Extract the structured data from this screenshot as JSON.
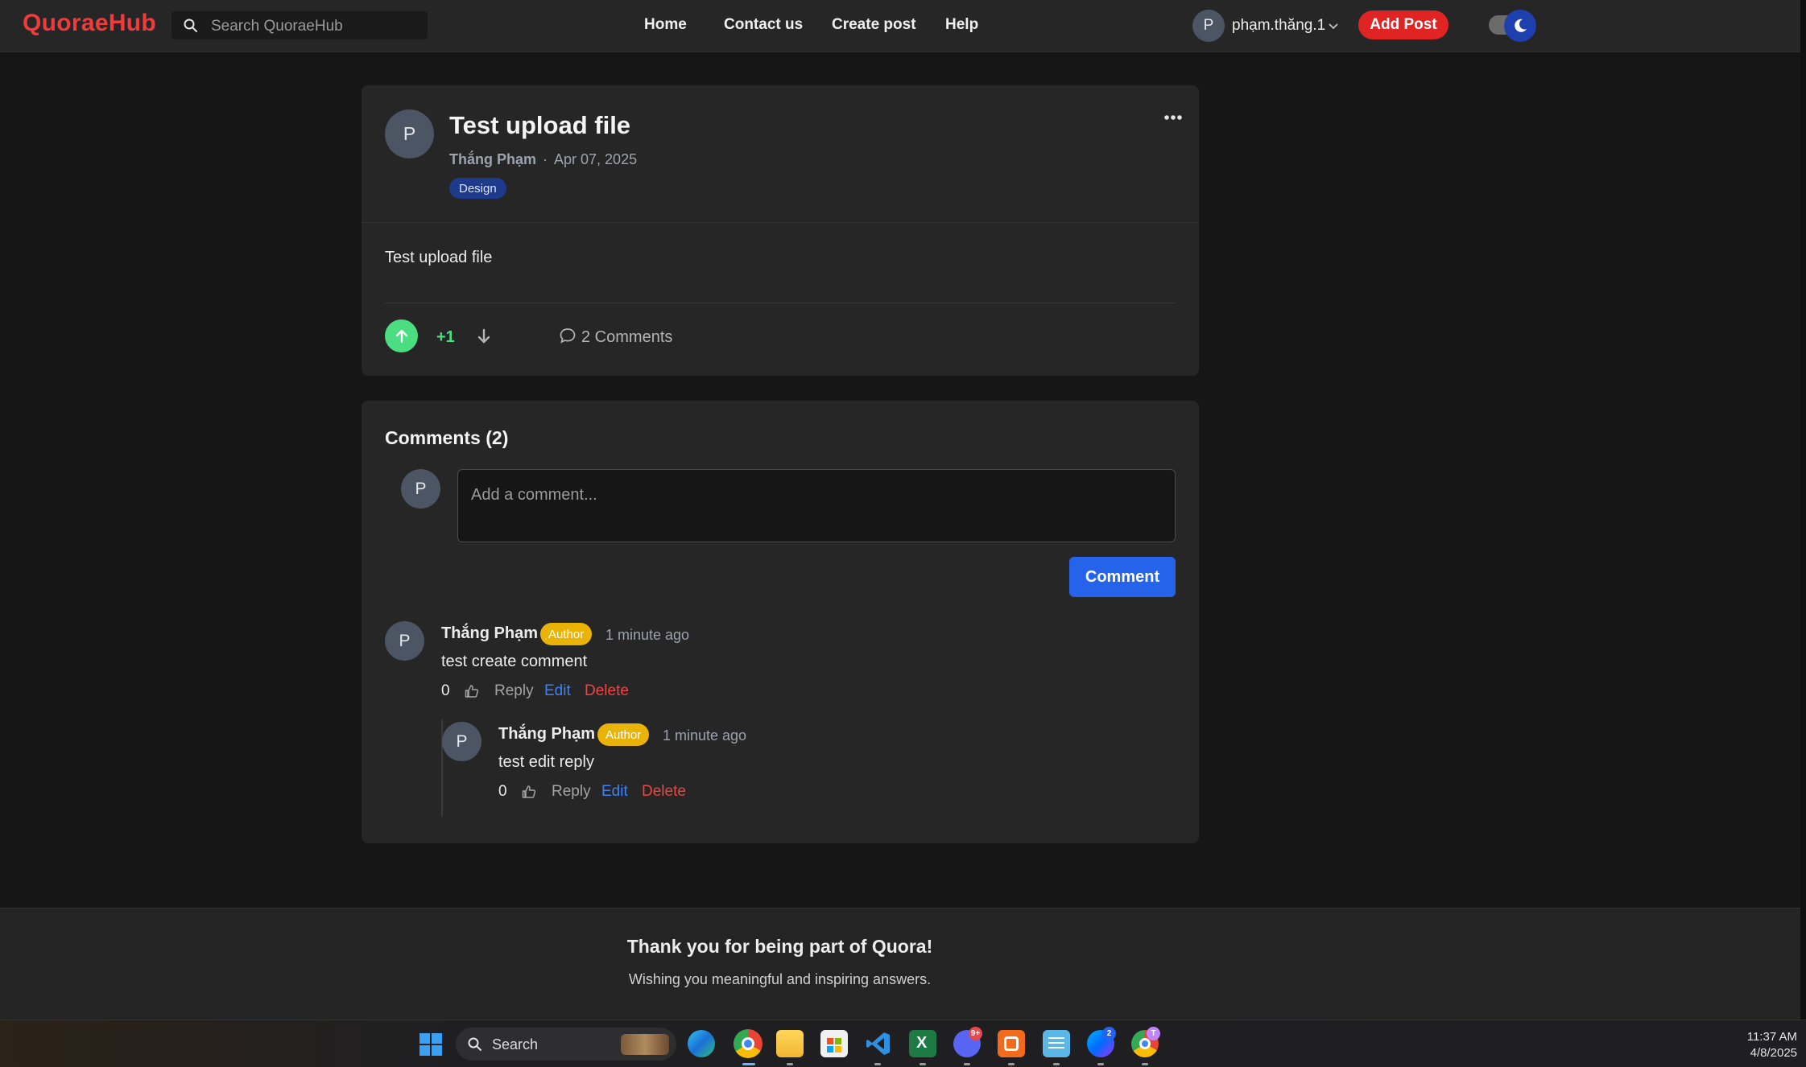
{
  "app": {
    "logo": "QuoraeHub"
  },
  "header": {
    "search_placeholder": "Search QuoraeHub",
    "nav": [
      "Home",
      "Contact us",
      "Create post",
      "Help"
    ],
    "user": {
      "initial": "P",
      "name": "phạm.thăng.1"
    },
    "add_post_label": "Add Post",
    "theme": "dark"
  },
  "post": {
    "avatar_initial": "P",
    "title": "Test upload file",
    "author": "Thắng Phạm",
    "date": "Apr 07, 2025",
    "tag": "Design",
    "body": "Test upload file",
    "votes": "+1",
    "comments_label": "2 Comments"
  },
  "comments": {
    "heading": "Comments (2)",
    "input_avatar_initial": "P",
    "input_placeholder": "Add a comment...",
    "submit_label": "Comment",
    "items": [
      {
        "initial": "P",
        "name": "Thắng Phạm",
        "badge": "Author",
        "time": "1 minute ago",
        "text": "test create comment",
        "likes": "0",
        "reply": "Reply",
        "edit": "Edit",
        "delete": "Delete"
      },
      {
        "initial": "P",
        "name": "Thắng Phạm",
        "badge": "Author",
        "time": "1 minute ago",
        "text": "test edit reply",
        "likes": "0",
        "reply": "Reply",
        "edit": "Edit",
        "delete": "Delete"
      }
    ]
  },
  "footer": {
    "title": "Thank you for being part of Quora!",
    "subtitle": "Wishing you meaningful and inspiring answers."
  },
  "taskbar": {
    "search_label": "Search",
    "time": "11:37 AM",
    "date": "4/8/2025",
    "apps": [
      "windows-start",
      "edge",
      "chrome",
      "file-explorer",
      "microsoft-store",
      "vscode",
      "excel",
      "discord",
      "xampp",
      "notepad",
      "messenger",
      "chrome-profile"
    ],
    "badges": {
      "discord": "9+",
      "messenger": "2",
      "chrome-profile": "T"
    }
  },
  "colors": {
    "brand": "#ef3b3b",
    "add_post": "#e02424",
    "primary_button": "#2563eb",
    "upvote": "#4ade80",
    "tag_bg": "#1e3a8a",
    "author_badge": "#eab308",
    "edit_link": "#3b82f6",
    "delete_link": "#ef4444",
    "background": "#161616",
    "card": "#262626"
  }
}
